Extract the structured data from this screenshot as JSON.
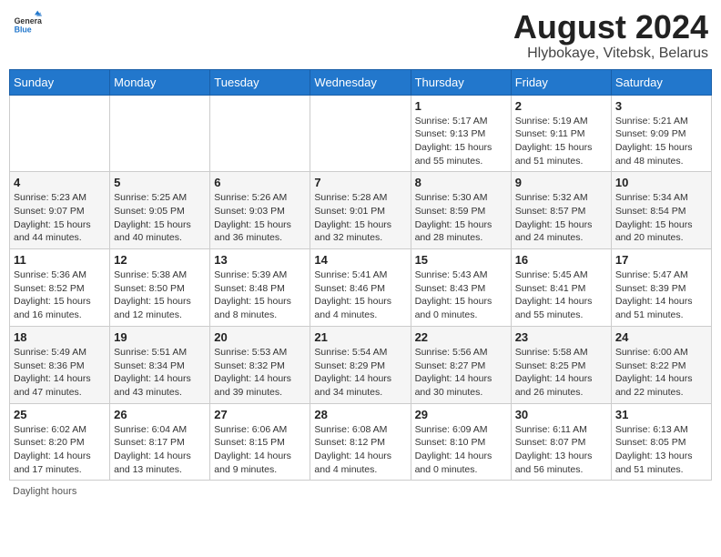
{
  "header": {
    "logo_general": "General",
    "logo_blue": "Blue",
    "month_title": "August 2024",
    "location": "Hlybokaye, Vitebsk, Belarus"
  },
  "weekdays": [
    "Sunday",
    "Monday",
    "Tuesday",
    "Wednesday",
    "Thursday",
    "Friday",
    "Saturday"
  ],
  "footer": "Daylight hours",
  "weeks": [
    [
      {
        "day": "",
        "sunrise": "",
        "sunset": "",
        "daylight": ""
      },
      {
        "day": "",
        "sunrise": "",
        "sunset": "",
        "daylight": ""
      },
      {
        "day": "",
        "sunrise": "",
        "sunset": "",
        "daylight": ""
      },
      {
        "day": "",
        "sunrise": "",
        "sunset": "",
        "daylight": ""
      },
      {
        "day": "1",
        "sunrise": "Sunrise: 5:17 AM",
        "sunset": "Sunset: 9:13 PM",
        "daylight": "Daylight: 15 hours and 55 minutes."
      },
      {
        "day": "2",
        "sunrise": "Sunrise: 5:19 AM",
        "sunset": "Sunset: 9:11 PM",
        "daylight": "Daylight: 15 hours and 51 minutes."
      },
      {
        "day": "3",
        "sunrise": "Sunrise: 5:21 AM",
        "sunset": "Sunset: 9:09 PM",
        "daylight": "Daylight: 15 hours and 48 minutes."
      }
    ],
    [
      {
        "day": "4",
        "sunrise": "Sunrise: 5:23 AM",
        "sunset": "Sunset: 9:07 PM",
        "daylight": "Daylight: 15 hours and 44 minutes."
      },
      {
        "day": "5",
        "sunrise": "Sunrise: 5:25 AM",
        "sunset": "Sunset: 9:05 PM",
        "daylight": "Daylight: 15 hours and 40 minutes."
      },
      {
        "day": "6",
        "sunrise": "Sunrise: 5:26 AM",
        "sunset": "Sunset: 9:03 PM",
        "daylight": "Daylight: 15 hours and 36 minutes."
      },
      {
        "day": "7",
        "sunrise": "Sunrise: 5:28 AM",
        "sunset": "Sunset: 9:01 PM",
        "daylight": "Daylight: 15 hours and 32 minutes."
      },
      {
        "day": "8",
        "sunrise": "Sunrise: 5:30 AM",
        "sunset": "Sunset: 8:59 PM",
        "daylight": "Daylight: 15 hours and 28 minutes."
      },
      {
        "day": "9",
        "sunrise": "Sunrise: 5:32 AM",
        "sunset": "Sunset: 8:57 PM",
        "daylight": "Daylight: 15 hours and 24 minutes."
      },
      {
        "day": "10",
        "sunrise": "Sunrise: 5:34 AM",
        "sunset": "Sunset: 8:54 PM",
        "daylight": "Daylight: 15 hours and 20 minutes."
      }
    ],
    [
      {
        "day": "11",
        "sunrise": "Sunrise: 5:36 AM",
        "sunset": "Sunset: 8:52 PM",
        "daylight": "Daylight: 15 hours and 16 minutes."
      },
      {
        "day": "12",
        "sunrise": "Sunrise: 5:38 AM",
        "sunset": "Sunset: 8:50 PM",
        "daylight": "Daylight: 15 hours and 12 minutes."
      },
      {
        "day": "13",
        "sunrise": "Sunrise: 5:39 AM",
        "sunset": "Sunset: 8:48 PM",
        "daylight": "Daylight: 15 hours and 8 minutes."
      },
      {
        "day": "14",
        "sunrise": "Sunrise: 5:41 AM",
        "sunset": "Sunset: 8:46 PM",
        "daylight": "Daylight: 15 hours and 4 minutes."
      },
      {
        "day": "15",
        "sunrise": "Sunrise: 5:43 AM",
        "sunset": "Sunset: 8:43 PM",
        "daylight": "Daylight: 15 hours and 0 minutes."
      },
      {
        "day": "16",
        "sunrise": "Sunrise: 5:45 AM",
        "sunset": "Sunset: 8:41 PM",
        "daylight": "Daylight: 14 hours and 55 minutes."
      },
      {
        "day": "17",
        "sunrise": "Sunrise: 5:47 AM",
        "sunset": "Sunset: 8:39 PM",
        "daylight": "Daylight: 14 hours and 51 minutes."
      }
    ],
    [
      {
        "day": "18",
        "sunrise": "Sunrise: 5:49 AM",
        "sunset": "Sunset: 8:36 PM",
        "daylight": "Daylight: 14 hours and 47 minutes."
      },
      {
        "day": "19",
        "sunrise": "Sunrise: 5:51 AM",
        "sunset": "Sunset: 8:34 PM",
        "daylight": "Daylight: 14 hours and 43 minutes."
      },
      {
        "day": "20",
        "sunrise": "Sunrise: 5:53 AM",
        "sunset": "Sunset: 8:32 PM",
        "daylight": "Daylight: 14 hours and 39 minutes."
      },
      {
        "day": "21",
        "sunrise": "Sunrise: 5:54 AM",
        "sunset": "Sunset: 8:29 PM",
        "daylight": "Daylight: 14 hours and 34 minutes."
      },
      {
        "day": "22",
        "sunrise": "Sunrise: 5:56 AM",
        "sunset": "Sunset: 8:27 PM",
        "daylight": "Daylight: 14 hours and 30 minutes."
      },
      {
        "day": "23",
        "sunrise": "Sunrise: 5:58 AM",
        "sunset": "Sunset: 8:25 PM",
        "daylight": "Daylight: 14 hours and 26 minutes."
      },
      {
        "day": "24",
        "sunrise": "Sunrise: 6:00 AM",
        "sunset": "Sunset: 8:22 PM",
        "daylight": "Daylight: 14 hours and 22 minutes."
      }
    ],
    [
      {
        "day": "25",
        "sunrise": "Sunrise: 6:02 AM",
        "sunset": "Sunset: 8:20 PM",
        "daylight": "Daylight: 14 hours and 17 minutes."
      },
      {
        "day": "26",
        "sunrise": "Sunrise: 6:04 AM",
        "sunset": "Sunset: 8:17 PM",
        "daylight": "Daylight: 14 hours and 13 minutes."
      },
      {
        "day": "27",
        "sunrise": "Sunrise: 6:06 AM",
        "sunset": "Sunset: 8:15 PM",
        "daylight": "Daylight: 14 hours and 9 minutes."
      },
      {
        "day": "28",
        "sunrise": "Sunrise: 6:08 AM",
        "sunset": "Sunset: 8:12 PM",
        "daylight": "Daylight: 14 hours and 4 minutes."
      },
      {
        "day": "29",
        "sunrise": "Sunrise: 6:09 AM",
        "sunset": "Sunset: 8:10 PM",
        "daylight": "Daylight: 14 hours and 0 minutes."
      },
      {
        "day": "30",
        "sunrise": "Sunrise: 6:11 AM",
        "sunset": "Sunset: 8:07 PM",
        "daylight": "Daylight: 13 hours and 56 minutes."
      },
      {
        "day": "31",
        "sunrise": "Sunrise: 6:13 AM",
        "sunset": "Sunset: 8:05 PM",
        "daylight": "Daylight: 13 hours and 51 minutes."
      }
    ]
  ]
}
